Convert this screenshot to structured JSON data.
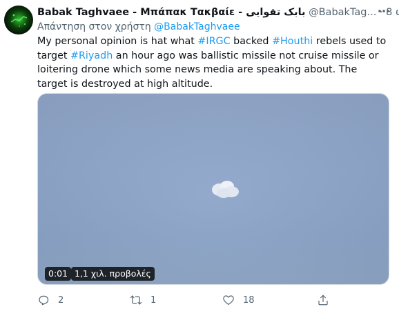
{
  "tweet": {
    "display_name": "Babak Taghvaee - Μπάπακ Τακβαίε - بابک تقوایی",
    "handle": "@BabakTag...",
    "separator": "·",
    "time": "8 ώ",
    "reply_prefix": "Απάντηση στον χρήστη",
    "reply_handle": "@BabakTaghvaee",
    "text_1": "My personal opinion is hat what ",
    "hashtag_1": "#IRGC",
    "text_2": " backed ",
    "hashtag_2": "#Houthi",
    "text_3": " rebels used to target ",
    "hashtag_3": "#Riyadh",
    "text_4": " an hour ago was ballistic missile not cruise missile or loitering drone which some news media are speaking about. The target is destroyed at high altitude."
  },
  "media": {
    "duration": "0:01",
    "views": "1,1 χιλ. προβολές"
  },
  "actions": {
    "reply_count": "2",
    "retweet_count": "1",
    "like_count": "18"
  },
  "icons": {
    "more": "more-horizontal-icon",
    "reply": "reply-icon",
    "retweet": "retweet-icon",
    "like": "heart-icon",
    "share": "share-icon"
  },
  "colors": {
    "accent": "#1d9bf0",
    "secondary_text": "#536471",
    "primary_text": "#0f1419"
  }
}
